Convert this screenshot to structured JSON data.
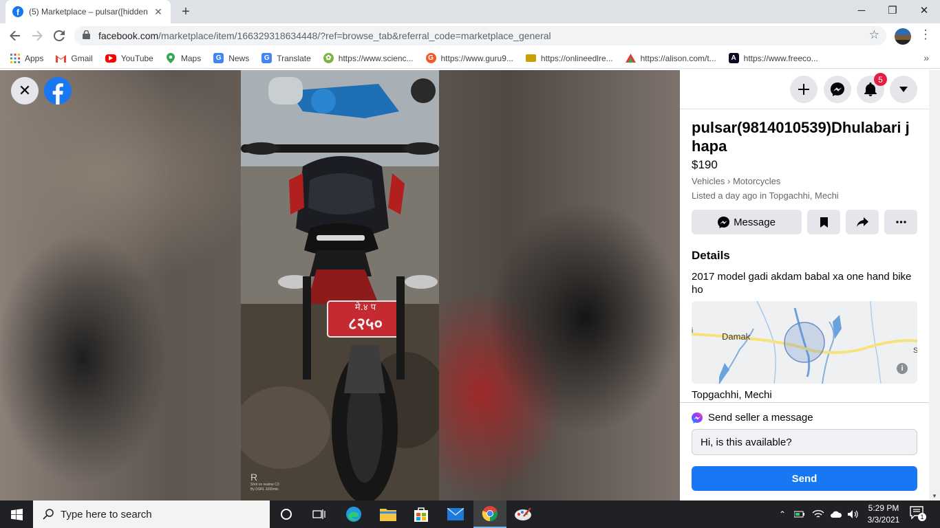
{
  "browser": {
    "tab": {
      "title": "(5) Marketplace – pulsar([hidden",
      "favicon": "facebook-icon",
      "close": "✕"
    },
    "new_tab": "+",
    "window": {
      "minimize": "─",
      "restore": "❐",
      "close": "✕"
    },
    "url": {
      "host": "facebook.com",
      "rest": "/marketplace/item/166329318634448/?ref=browse_tab&referral_code=marketplace_general"
    },
    "bookmarks": [
      {
        "label": "Apps",
        "icon": "apps-grid-icon",
        "color": "#4285f4"
      },
      {
        "label": "Gmail",
        "icon": "gmail-icon",
        "color": "#ea4335"
      },
      {
        "label": "YouTube",
        "icon": "youtube-icon",
        "color": "#ff0000"
      },
      {
        "label": "Maps",
        "icon": "maps-icon",
        "color": "#34a853"
      },
      {
        "label": "News",
        "icon": "news-icon",
        "color": "#4285f4"
      },
      {
        "label": "Translate",
        "icon": "translate-icon",
        "color": "#4285f4"
      },
      {
        "label": "https://www.scienc...",
        "icon": "science-icon",
        "color": "#5f9e3a"
      },
      {
        "label": "https://www.guru9...",
        "icon": "guru-icon",
        "color": "#f15a24"
      },
      {
        "label": "https://onlineedlre...",
        "icon": "onlineedl-icon",
        "color": "#c8a000"
      },
      {
        "label": "https://alison.com/t...",
        "icon": "alison-icon",
        "color": "#e53935"
      },
      {
        "label": "https://www.freeco...",
        "icon": "freecodecamp-icon",
        "color": "#0a0a23"
      }
    ],
    "bookmarks_more": "»"
  },
  "viewer": {
    "close": "✕",
    "watermark_line1": "Shot on realme C3",
    "watermark_line2": "By DSRL 3265mls",
    "plate_top": "मे.४ प",
    "plate_bottom": "८२५०"
  },
  "panel": {
    "notifications_count": "5",
    "title": "pulsar(9814010539)Dhulabari jhapa",
    "price": "$190",
    "category": "Vehicles › Motorcycles",
    "listed": "Listed a day ago in Topgachhi, Mechi",
    "message_button": "Message",
    "details_heading": "Details",
    "description": "2017 model gadi akdam babal xa one hand bike ho",
    "map": {
      "label_damak": "Damak",
      "label_i": "i",
      "label_s": "S"
    },
    "location": "Topgachhi, Mechi",
    "send_heading": "Send seller a message",
    "input_value": "Hi, is this available?",
    "send_button": "Send",
    "brand_color": "#1877f2"
  },
  "taskbar": {
    "search_placeholder": "Type here to search",
    "time": "5:29 PM",
    "date": "3/3/2021",
    "notification_count": "1"
  }
}
